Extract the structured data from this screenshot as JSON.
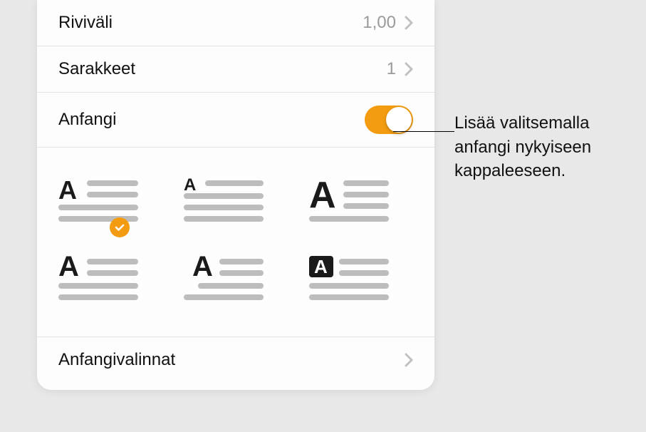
{
  "rows": {
    "linespacing": {
      "label": "Riviväli",
      "value": "1,00"
    },
    "columns": {
      "label": "Sarakkeet",
      "value": "1"
    },
    "dropcap": {
      "label": "Anfangi"
    },
    "dropcapoptions": {
      "label": "Anfangivalinnat"
    }
  },
  "callout": {
    "line1": "Lisää valitsemalla",
    "line2": "anfangi nykyiseen",
    "line3": "kappaleeseen."
  }
}
